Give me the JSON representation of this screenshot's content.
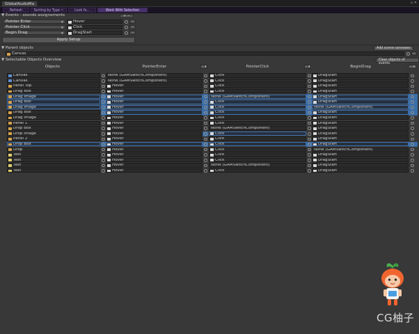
{
  "window": {
    "tab_title": "GlobalAudioMa",
    "controls": "▫ ✕"
  },
  "toolbar": {
    "buttons": [
      "Refresh",
      "Sorting by Type ~",
      "Look fo...",
      "Work With Selection"
    ]
  },
  "events_section": {
    "title": "Events - sounds assignements",
    "fold": "▼",
    "header_btn": "+  −",
    "assignments": [
      {
        "event": "Pointer Enter",
        "sound": "Hover"
      },
      {
        "event": "Pointer Click",
        "sound": "Click"
      },
      {
        "event": "Begin Drag",
        "sound": "DragStart"
      }
    ],
    "apply_label": "Apply Setup"
  },
  "parent_section": {
    "title": "Parent objects",
    "fold": "▼",
    "add_button": "Add scene canvases",
    "canvas": "Canvas"
  },
  "overview_section": {
    "title": "Selectable Objects Overview",
    "fold": "▼",
    "clear_button": "Clear objects of events",
    "columns": [
      "Objects",
      "PointerEnter",
      "PointerClick",
      "BeginDrag"
    ],
    "column_buttons": [
      "─ ▾",
      "─ ▾",
      "─ ▾"
    ],
    "rows": [
      {
        "obj": "Canvas",
        "type": "canvas",
        "enter": "None (GAMSwitchComponent)",
        "click": "Click",
        "drag": "DragStart",
        "hl": []
      },
      {
        "obj": "Canvas",
        "type": "canvas",
        "enter": "None (GAMSwitchComponent)",
        "click": "Click",
        "drag": "DragStart",
        "hl": []
      },
      {
        "obj": "Panel Top",
        "type": "image",
        "enter": "Hover",
        "click": "Click",
        "drag": "DragStart",
        "hl": []
      },
      {
        "obj": "Drag Box",
        "type": "image",
        "enter": "Hover",
        "click": "Click",
        "drag": "DragStart",
        "hl": []
      },
      {
        "obj": "Drag Image",
        "type": "image",
        "enter": "Hover",
        "click": "None (GAMSwitchComponent)",
        "drag": "DragStart",
        "hl": [
          "obj",
          "enter",
          "click",
          "drag"
        ]
      },
      {
        "obj": "Drag Box",
        "type": "image",
        "enter": "Hover",
        "click": "Click",
        "drag": "DragStart",
        "hl": [
          "obj",
          "enter",
          "click",
          "drag"
        ]
      },
      {
        "obj": "Drag Image",
        "type": "image",
        "enter": "Hover",
        "click": "Click",
        "drag": "None (GAMSwitchComponent)",
        "hl": [
          "obj",
          "enter",
          "click",
          "drag"
        ]
      },
      {
        "obj": "Drag Box",
        "type": "image",
        "enter": "Hover",
        "click": "Click",
        "drag": "DragStart",
        "hl": [
          "enter",
          "click",
          "drag"
        ]
      },
      {
        "obj": "Drag Image",
        "type": "image",
        "enter": "Hover",
        "click": "Click",
        "drag": "DragStart",
        "hl": []
      },
      {
        "obj": "Panel 1",
        "type": "image",
        "enter": "Hover",
        "click": "Click",
        "drag": "DragStart",
        "hl": []
      },
      {
        "obj": "Drop Box",
        "type": "image",
        "enter": "Hover",
        "click": "None (GAMSwitchComponent)",
        "drag": "DragStart",
        "hl": []
      },
      {
        "obj": "Drop Image",
        "type": "image",
        "enter": "Hover",
        "click": "Click",
        "drag": "DragStart",
        "hl": [
          "click"
        ]
      },
      {
        "obj": "Panel 2",
        "type": "image",
        "enter": "Hover",
        "click": "Click",
        "drag": "DragStart",
        "hl": []
      },
      {
        "obj": "Drop Box",
        "type": "image",
        "enter": "Hover",
        "click": "Click",
        "drag": "DragStart",
        "hl": [
          "obj",
          "enter",
          "click",
          "drag"
        ]
      },
      {
        "obj": "Drop",
        "type": "image",
        "enter": "Hover",
        "click": "Click",
        "drag": "None (GAMSwitchComponent)",
        "hl": []
      },
      {
        "obj": "Text",
        "type": "text",
        "enter": "Hover",
        "click": "Click",
        "drag": "DragStart",
        "hl": []
      },
      {
        "obj": "Text",
        "type": "text",
        "enter": "Hover",
        "click": "Click",
        "drag": "DragStart",
        "hl": []
      },
      {
        "obj": "Text",
        "type": "text",
        "enter": "Hover",
        "click": "None (GAMSwitchComponent)",
        "drag": "DragStart",
        "hl": []
      },
      {
        "obj": "Text",
        "type": "text",
        "enter": "Hover",
        "click": "Click",
        "drag": "DragStart",
        "hl": []
      }
    ]
  },
  "watermark": {
    "text": "CG柚子"
  },
  "colors": {
    "background": "#383838",
    "toolbar": "#1a1324",
    "selection": "#3a6ea8"
  }
}
